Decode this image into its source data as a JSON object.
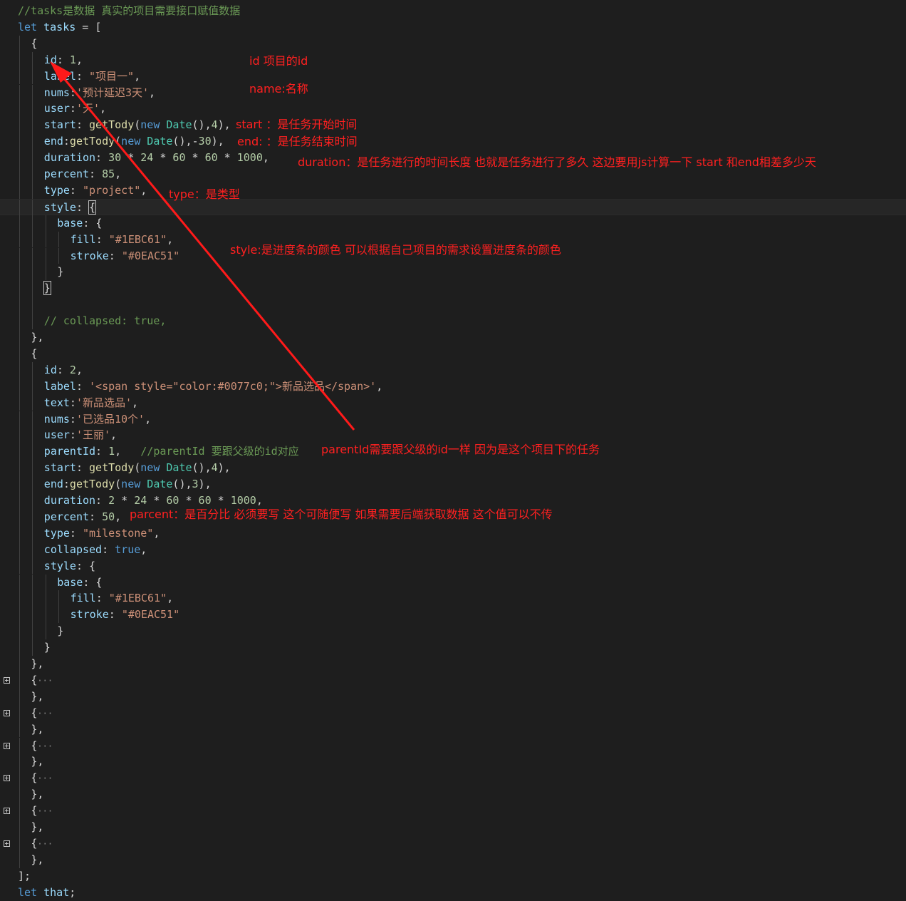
{
  "code_lines": [
    {
      "n": 0,
      "indent": 0,
      "tokens": [
        [
          "cmt",
          "//tasks是数据 真实的项目需要接口赋值数据"
        ]
      ]
    },
    {
      "n": 1,
      "indent": 0,
      "tokens": [
        [
          "kw",
          "let "
        ],
        [
          "prop",
          "tasks"
        ],
        [
          "pun",
          " = ["
        ]
      ]
    },
    {
      "n": 2,
      "indent": 1,
      "tokens": [
        [
          "pun",
          "{"
        ]
      ]
    },
    {
      "n": 3,
      "indent": 2,
      "tokens": [
        [
          "prop",
          "id"
        ],
        [
          "pun",
          ": "
        ],
        [
          "num",
          "1"
        ],
        [
          "pun",
          ","
        ]
      ]
    },
    {
      "n": 4,
      "indent": 2,
      "tokens": [
        [
          "prop",
          "label"
        ],
        [
          "pun",
          ": "
        ],
        [
          "str",
          "\"项目一\""
        ],
        [
          "pun",
          ","
        ]
      ]
    },
    {
      "n": 5,
      "indent": 2,
      "tokens": [
        [
          "prop",
          "nums"
        ],
        [
          "pun",
          ":"
        ],
        [
          "str",
          "'预计延迟3天'"
        ],
        [
          "pun",
          ","
        ]
      ]
    },
    {
      "n": 6,
      "indent": 2,
      "tokens": [
        [
          "prop",
          "user"
        ],
        [
          "pun",
          ":"
        ],
        [
          "str",
          "'天'"
        ],
        [
          "pun",
          ","
        ]
      ]
    },
    {
      "n": 7,
      "indent": 2,
      "tokens": [
        [
          "prop",
          "start"
        ],
        [
          "pun",
          ": "
        ],
        [
          "fn",
          "getTody"
        ],
        [
          "pun",
          "("
        ],
        [
          "kw",
          "new "
        ],
        [
          "cls",
          "Date"
        ],
        [
          "pun",
          "(),"
        ],
        [
          "num",
          "4"
        ],
        [
          "pun",
          "),"
        ]
      ]
    },
    {
      "n": 8,
      "indent": 2,
      "tokens": [
        [
          "prop",
          "end"
        ],
        [
          "pun",
          ":"
        ],
        [
          "fn",
          "getTody"
        ],
        [
          "pun",
          "("
        ],
        [
          "kw",
          "new "
        ],
        [
          "cls",
          "Date"
        ],
        [
          "pun",
          "(),-"
        ],
        [
          "num",
          "30"
        ],
        [
          "pun",
          "),"
        ]
      ]
    },
    {
      "n": 9,
      "indent": 2,
      "tokens": [
        [
          "prop",
          "duration"
        ],
        [
          "pun",
          ": "
        ],
        [
          "num",
          "30"
        ],
        [
          "pun",
          " * "
        ],
        [
          "num",
          "24"
        ],
        [
          "pun",
          " * "
        ],
        [
          "num",
          "60"
        ],
        [
          "pun",
          " * "
        ],
        [
          "num",
          "60"
        ],
        [
          "pun",
          " * "
        ],
        [
          "num",
          "1000"
        ],
        [
          "pun",
          ","
        ]
      ]
    },
    {
      "n": 10,
      "indent": 2,
      "tokens": [
        [
          "prop",
          "percent"
        ],
        [
          "pun",
          ": "
        ],
        [
          "num",
          "85"
        ],
        [
          "pun",
          ","
        ]
      ]
    },
    {
      "n": 11,
      "indent": 2,
      "tokens": [
        [
          "prop",
          "type"
        ],
        [
          "pun",
          ": "
        ],
        [
          "str",
          "\"project\""
        ],
        [
          "pun",
          ","
        ]
      ]
    },
    {
      "n": 12,
      "indent": 2,
      "current": true,
      "tokens": [
        [
          "prop",
          "style"
        ],
        [
          "pun",
          ": "
        ],
        [
          "pun",
          "{",
          "box"
        ]
      ]
    },
    {
      "n": 13,
      "indent": 3,
      "tokens": [
        [
          "prop",
          "base"
        ],
        [
          "pun",
          ": {"
        ]
      ]
    },
    {
      "n": 14,
      "indent": 4,
      "tokens": [
        [
          "prop",
          "fill"
        ],
        [
          "pun",
          ": "
        ],
        [
          "str",
          "\"#1EBC61\""
        ],
        [
          "pun",
          ","
        ]
      ]
    },
    {
      "n": 15,
      "indent": 4,
      "tokens": [
        [
          "prop",
          "stroke"
        ],
        [
          "pun",
          ": "
        ],
        [
          "str",
          "\"#0EAC51\""
        ]
      ]
    },
    {
      "n": 16,
      "indent": 3,
      "tokens": [
        [
          "pun",
          "}"
        ]
      ]
    },
    {
      "n": 17,
      "indent": 2,
      "tokens": [
        [
          "pun",
          "}",
          "box"
        ]
      ]
    },
    {
      "n": 18,
      "indent": 2,
      "tokens": []
    },
    {
      "n": 19,
      "indent": 2,
      "tokens": [
        [
          "cmt",
          "// collapsed: true,"
        ]
      ]
    },
    {
      "n": 20,
      "indent": 1,
      "tokens": [
        [
          "pun",
          "},"
        ]
      ]
    },
    {
      "n": 21,
      "indent": 1,
      "tokens": [
        [
          "pun",
          "{"
        ]
      ]
    },
    {
      "n": 22,
      "indent": 2,
      "tokens": [
        [
          "prop",
          "id"
        ],
        [
          "pun",
          ": "
        ],
        [
          "num",
          "2"
        ],
        [
          "pun",
          ","
        ]
      ]
    },
    {
      "n": 23,
      "indent": 2,
      "tokens": [
        [
          "prop",
          "label"
        ],
        [
          "pun",
          ": "
        ],
        [
          "str",
          "'<span style=\"color:#0077c0;\">新品选品</span>'"
        ],
        [
          "pun",
          ","
        ]
      ]
    },
    {
      "n": 24,
      "indent": 2,
      "tokens": [
        [
          "prop",
          "text"
        ],
        [
          "pun",
          ":"
        ],
        [
          "str",
          "'新品选品'"
        ],
        [
          "pun",
          ","
        ]
      ]
    },
    {
      "n": 25,
      "indent": 2,
      "tokens": [
        [
          "prop",
          "nums"
        ],
        [
          "pun",
          ":"
        ],
        [
          "str",
          "'已选品10个'"
        ],
        [
          "pun",
          ","
        ]
      ]
    },
    {
      "n": 26,
      "indent": 2,
      "tokens": [
        [
          "prop",
          "user"
        ],
        [
          "pun",
          ":"
        ],
        [
          "str",
          "'王丽'"
        ],
        [
          "pun",
          ","
        ]
      ]
    },
    {
      "n": 27,
      "indent": 2,
      "tokens": [
        [
          "prop",
          "parentId"
        ],
        [
          "pun",
          ": "
        ],
        [
          "num",
          "1"
        ],
        [
          "pun",
          ",   "
        ],
        [
          "cmt",
          "//parentId 要跟父级的id对应"
        ]
      ]
    },
    {
      "n": 28,
      "indent": 2,
      "tokens": [
        [
          "prop",
          "start"
        ],
        [
          "pun",
          ": "
        ],
        [
          "fn",
          "getTody"
        ],
        [
          "pun",
          "("
        ],
        [
          "kw",
          "new "
        ],
        [
          "cls",
          "Date"
        ],
        [
          "pun",
          "(),"
        ],
        [
          "num",
          "4"
        ],
        [
          "pun",
          "),"
        ]
      ]
    },
    {
      "n": 29,
      "indent": 2,
      "tokens": [
        [
          "prop",
          "end"
        ],
        [
          "pun",
          ":"
        ],
        [
          "fn",
          "getTody"
        ],
        [
          "pun",
          "("
        ],
        [
          "kw",
          "new "
        ],
        [
          "cls",
          "Date"
        ],
        [
          "pun",
          "(),"
        ],
        [
          "num",
          "3"
        ],
        [
          "pun",
          "),"
        ]
      ]
    },
    {
      "n": 30,
      "indent": 2,
      "tokens": [
        [
          "prop",
          "duration"
        ],
        [
          "pun",
          ": "
        ],
        [
          "num",
          "2"
        ],
        [
          "pun",
          " * "
        ],
        [
          "num",
          "24"
        ],
        [
          "pun",
          " * "
        ],
        [
          "num",
          "60"
        ],
        [
          "pun",
          " * "
        ],
        [
          "num",
          "60"
        ],
        [
          "pun",
          " * "
        ],
        [
          "num",
          "1000"
        ],
        [
          "pun",
          ","
        ]
      ]
    },
    {
      "n": 31,
      "indent": 2,
      "tokens": [
        [
          "prop",
          "percent"
        ],
        [
          "pun",
          ": "
        ],
        [
          "num",
          "50"
        ],
        [
          "pun",
          ","
        ]
      ]
    },
    {
      "n": 32,
      "indent": 2,
      "tokens": [
        [
          "prop",
          "type"
        ],
        [
          "pun",
          ": "
        ],
        [
          "str",
          "\"milestone\""
        ],
        [
          "pun",
          ","
        ]
      ]
    },
    {
      "n": 33,
      "indent": 2,
      "tokens": [
        [
          "prop",
          "collapsed"
        ],
        [
          "pun",
          ": "
        ],
        [
          "kw",
          "true"
        ],
        [
          "pun",
          ","
        ]
      ]
    },
    {
      "n": 34,
      "indent": 2,
      "tokens": [
        [
          "prop",
          "style"
        ],
        [
          "pun",
          ": {"
        ]
      ]
    },
    {
      "n": 35,
      "indent": 3,
      "tokens": [
        [
          "prop",
          "base"
        ],
        [
          "pun",
          ": {"
        ]
      ]
    },
    {
      "n": 36,
      "indent": 4,
      "tokens": [
        [
          "prop",
          "fill"
        ],
        [
          "pun",
          ": "
        ],
        [
          "str",
          "\"#1EBC61\""
        ],
        [
          "pun",
          ","
        ]
      ]
    },
    {
      "n": 37,
      "indent": 4,
      "tokens": [
        [
          "prop",
          "stroke"
        ],
        [
          "pun",
          ": "
        ],
        [
          "str",
          "\"#0EAC51\""
        ]
      ]
    },
    {
      "n": 38,
      "indent": 3,
      "tokens": [
        [
          "pun",
          "}"
        ]
      ]
    },
    {
      "n": 39,
      "indent": 2,
      "tokens": [
        [
          "pun",
          "}"
        ]
      ]
    },
    {
      "n": 40,
      "indent": 1,
      "tokens": [
        [
          "pun",
          "},"
        ]
      ]
    },
    {
      "n": 41,
      "indent": 1,
      "fold": true,
      "tokens": [
        [
          "pun",
          "{"
        ],
        [
          "ell",
          "···"
        ]
      ]
    },
    {
      "n": 42,
      "indent": 1,
      "tokens": [
        [
          "pun",
          "},"
        ]
      ]
    },
    {
      "n": 43,
      "indent": 1,
      "fold": true,
      "tokens": [
        [
          "pun",
          "{"
        ],
        [
          "ell",
          "···"
        ]
      ]
    },
    {
      "n": 44,
      "indent": 1,
      "tokens": [
        [
          "pun",
          "},"
        ]
      ]
    },
    {
      "n": 45,
      "indent": 1,
      "fold": true,
      "tokens": [
        [
          "pun",
          "{"
        ],
        [
          "ell",
          "···"
        ]
      ]
    },
    {
      "n": 46,
      "indent": 1,
      "tokens": [
        [
          "pun",
          "},"
        ]
      ]
    },
    {
      "n": 47,
      "indent": 1,
      "fold": true,
      "tokens": [
        [
          "pun",
          "{"
        ],
        [
          "ell",
          "···"
        ]
      ]
    },
    {
      "n": 48,
      "indent": 1,
      "tokens": [
        [
          "pun",
          "},"
        ]
      ]
    },
    {
      "n": 49,
      "indent": 1,
      "fold": true,
      "tokens": [
        [
          "pun",
          "{"
        ],
        [
          "ell",
          "···"
        ]
      ]
    },
    {
      "n": 50,
      "indent": 1,
      "tokens": [
        [
          "pun",
          "},"
        ]
      ]
    },
    {
      "n": 51,
      "indent": 1,
      "fold": true,
      "tokens": [
        [
          "pun",
          "{"
        ],
        [
          "ell",
          "···"
        ]
      ]
    },
    {
      "n": 52,
      "indent": 1,
      "tokens": [
        [
          "pun",
          "},"
        ]
      ]
    },
    {
      "n": 53,
      "indent": 0,
      "tokens": [
        [
          "pun",
          "];"
        ]
      ]
    },
    {
      "n": 54,
      "indent": 0,
      "tokens": [
        [
          "kw",
          "let "
        ],
        [
          "prop",
          "that"
        ],
        [
          "pun",
          ";"
        ]
      ]
    }
  ],
  "annotations": {
    "id": "id 项目的id",
    "name": "name:名称",
    "start": "start ：是任务开始时间",
    "end": "end: ：是任务结束时间",
    "duration": "duration：是任务进行的时间长度 也就是任务进行了多久  这边要用js计算一下 start 和end相差多少天",
    "type": "type：是类型",
    "style": "style:是进度条的颜色 可以根据自己项目的需求设置进度条的颜色",
    "parentId": "parentId需要跟父级的id一样 因为是这个项目下的任务",
    "percent": "parcent：是百分比 必须要写 这个可随便写  如果需要后端获取数据 这个值可以不传"
  },
  "colors": {
    "background": "#1e1e1e",
    "keyword": "#569cd6",
    "property": "#9cdcfe",
    "string": "#ce9178",
    "number": "#b5cea8",
    "function": "#dcdcaa",
    "class": "#4ec9b0",
    "comment": "#6a9955",
    "annotation": "#ff2020"
  },
  "icons": {
    "fold": "plus-box-icon",
    "arrow": "red-arrow-icon"
  }
}
